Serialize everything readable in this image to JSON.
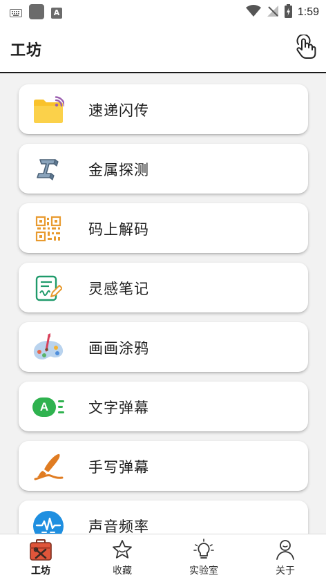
{
  "status_bar": {
    "time": "1:59",
    "icons": [
      "keyboard-icon",
      "app-square-icon",
      "font-a-icon",
      "wifi-icon",
      "no-signal-icon",
      "battery-charging-icon"
    ],
    "font_icon_glyph": "A"
  },
  "app_bar": {
    "title": "工坊",
    "action_icon": "touch-hand-icon"
  },
  "tools": [
    {
      "label": "速递闪传",
      "icon": "folder-signal-icon"
    },
    {
      "label": "金属探测",
      "icon": "steel-beam-icon"
    },
    {
      "label": "码上解码",
      "icon": "qr-code-icon"
    },
    {
      "label": "灵感笔记",
      "icon": "note-pen-icon"
    },
    {
      "label": "画画涂鸦",
      "icon": "paint-palette-icon"
    },
    {
      "label": "文字弹幕",
      "icon": "text-barrage-icon",
      "icon_text": "A"
    },
    {
      "label": "手写弹幕",
      "icon": "brush-stroke-icon"
    },
    {
      "label": "声音频率",
      "icon": "sound-wave-icon"
    }
  ],
  "bottom_nav": {
    "active": 0,
    "items": [
      {
        "label": "工坊",
        "icon": "toolbox-icon"
      },
      {
        "label": "收藏",
        "icon": "star-icon"
      },
      {
        "label": "实验室",
        "icon": "lightbulb-icon"
      },
      {
        "label": "关于",
        "icon": "person-icon"
      }
    ]
  },
  "colors": {
    "folder": "#f9c22b",
    "signal": "#9b5fb0",
    "steel": "#6f8ca6",
    "qr": "#e89a2e",
    "note": "#1f9a6a",
    "palette": "#a9c8ea",
    "barrage": "#2fb24f",
    "brush": "#e07c22",
    "sound": "#1f8fe0",
    "toolbox": "#e0553a"
  }
}
